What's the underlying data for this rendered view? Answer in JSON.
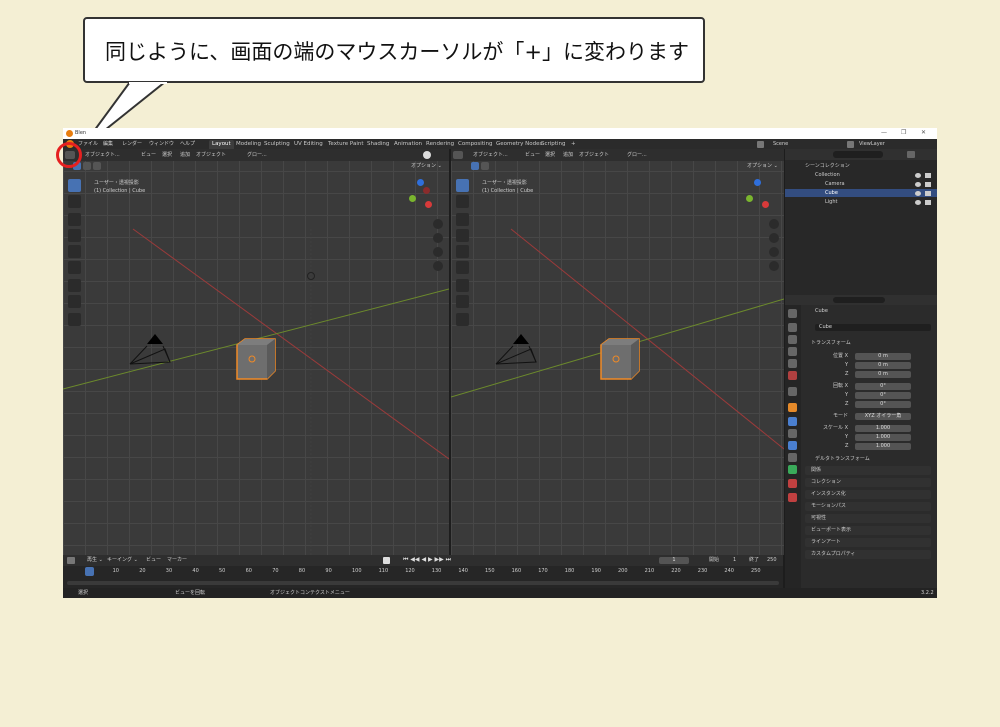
{
  "callout": {
    "text": "同じように、画面の端のマウスカーソルが「+」に変わります"
  },
  "window": {
    "title": "Blen",
    "controls": {
      "min": "—",
      "max": "❐",
      "close": "✕"
    }
  },
  "menu": [
    "ファイル",
    "編集",
    "レンダー",
    "ウィンドウ",
    "ヘルプ"
  ],
  "workspaces": [
    "Layout",
    "Modeling",
    "Sculpting",
    "UV Editing",
    "Texture Paint",
    "Shading",
    "Animation",
    "Rendering",
    "Compositing",
    "Geometry Nodes",
    "Scripting",
    "+"
  ],
  "scene": {
    "name": "Scene",
    "view_layer": "ViewLayer"
  },
  "viewport": {
    "mode": "オブジェクト...",
    "menus": [
      "ビュー",
      "選択",
      "追加",
      "オブジェクト"
    ],
    "transform": "グロー...",
    "options": "オプション ⌄",
    "label_line1": "ユーザー・透視投影",
    "label_line2": "(1) Collection | Cube",
    "gizmo": {
      "x": "X",
      "y": "Y",
      "z": "Z"
    }
  },
  "outliner": {
    "root": "シーンコレクション",
    "collection": "Collection",
    "items": [
      "Camera",
      "Cube",
      "Light"
    ]
  },
  "properties": {
    "object_name": "Cube",
    "data_name": "Cube",
    "transform_header": "トランスフォーム",
    "location_label": "位置 X",
    "rotation_label": "回転 X",
    "scale_label": "スケール X",
    "y": "Y",
    "z": "Z",
    "location": [
      "0 m",
      "0 m",
      "0 m"
    ],
    "rotation": [
      "0°",
      "0°",
      "0°"
    ],
    "mode_label": "モード",
    "mode_value": "XYZ オイラー角",
    "scale": [
      "1.000",
      "1.000",
      "1.000"
    ],
    "delta": "デルタトランスフォーム",
    "panels": [
      "関係",
      "コレクション",
      "インスタンス化",
      "モーションパス",
      "可視性",
      "ビューポート表示",
      "ラインアート",
      "カスタムプロパティ"
    ]
  },
  "timeline": {
    "menus": [
      "再生 ⌄",
      "キーイング ⌄",
      "ビュー",
      "マーカー"
    ],
    "current_frame": "1",
    "start_label": "開始",
    "start": "1",
    "end_label": "終了",
    "end": "250",
    "ticks": [
      "1",
      "10",
      "20",
      "30",
      "40",
      "50",
      "60",
      "70",
      "80",
      "90",
      "100",
      "110",
      "120",
      "130",
      "140",
      "150",
      "160",
      "170",
      "180",
      "190",
      "200",
      "210",
      "220",
      "230",
      "240",
      "250"
    ]
  },
  "status": {
    "select": "選択",
    "rotate": "ビューを回転",
    "context": "オブジェクトコンテクストメニュー",
    "version": "3.2.2"
  }
}
